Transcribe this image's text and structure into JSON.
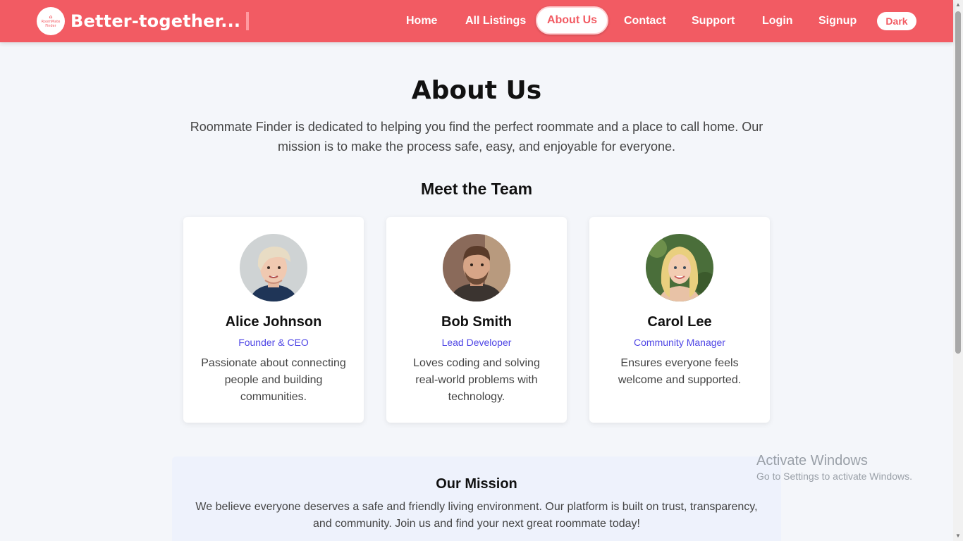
{
  "navbar": {
    "logo_mark": "⌂",
    "logo_text": "RoomMate Finder",
    "brand": "Better-together...",
    "links": [
      {
        "label": "Home"
      },
      {
        "label": "All Listings"
      },
      {
        "label": "About Us",
        "active": true
      },
      {
        "label": "Contact"
      },
      {
        "label": "Support"
      },
      {
        "label": "Login"
      },
      {
        "label": "Signup"
      }
    ],
    "theme_toggle": "Dark",
    "accent_color": "#f25b63"
  },
  "page": {
    "title": "About Us",
    "intro": "Roommate Finder is dedicated to helping you find the perfect roommate and a place to call home. Our mission is to make the process safe, easy, and enjoyable for everyone.",
    "team_heading": "Meet the Team",
    "team": [
      {
        "name": "Alice Johnson",
        "role": "Founder & CEO",
        "bio": "Passionate about connecting people and building communities."
      },
      {
        "name": "Bob Smith",
        "role": "Lead Developer",
        "bio": "Loves coding and solving real-world problems with technology."
      },
      {
        "name": "Carol Lee",
        "role": "Community Manager",
        "bio": "Ensures everyone feels welcome and supported."
      }
    ],
    "mission": {
      "title": "Our Mission",
      "text": "We believe everyone deserves a safe and friendly living environment. Our platform is built on trust, transparency, and community. Join us and find your next great roommate today!"
    }
  },
  "watermark": {
    "title": "Activate Windows",
    "subtitle": "Go to Settings to activate Windows."
  }
}
